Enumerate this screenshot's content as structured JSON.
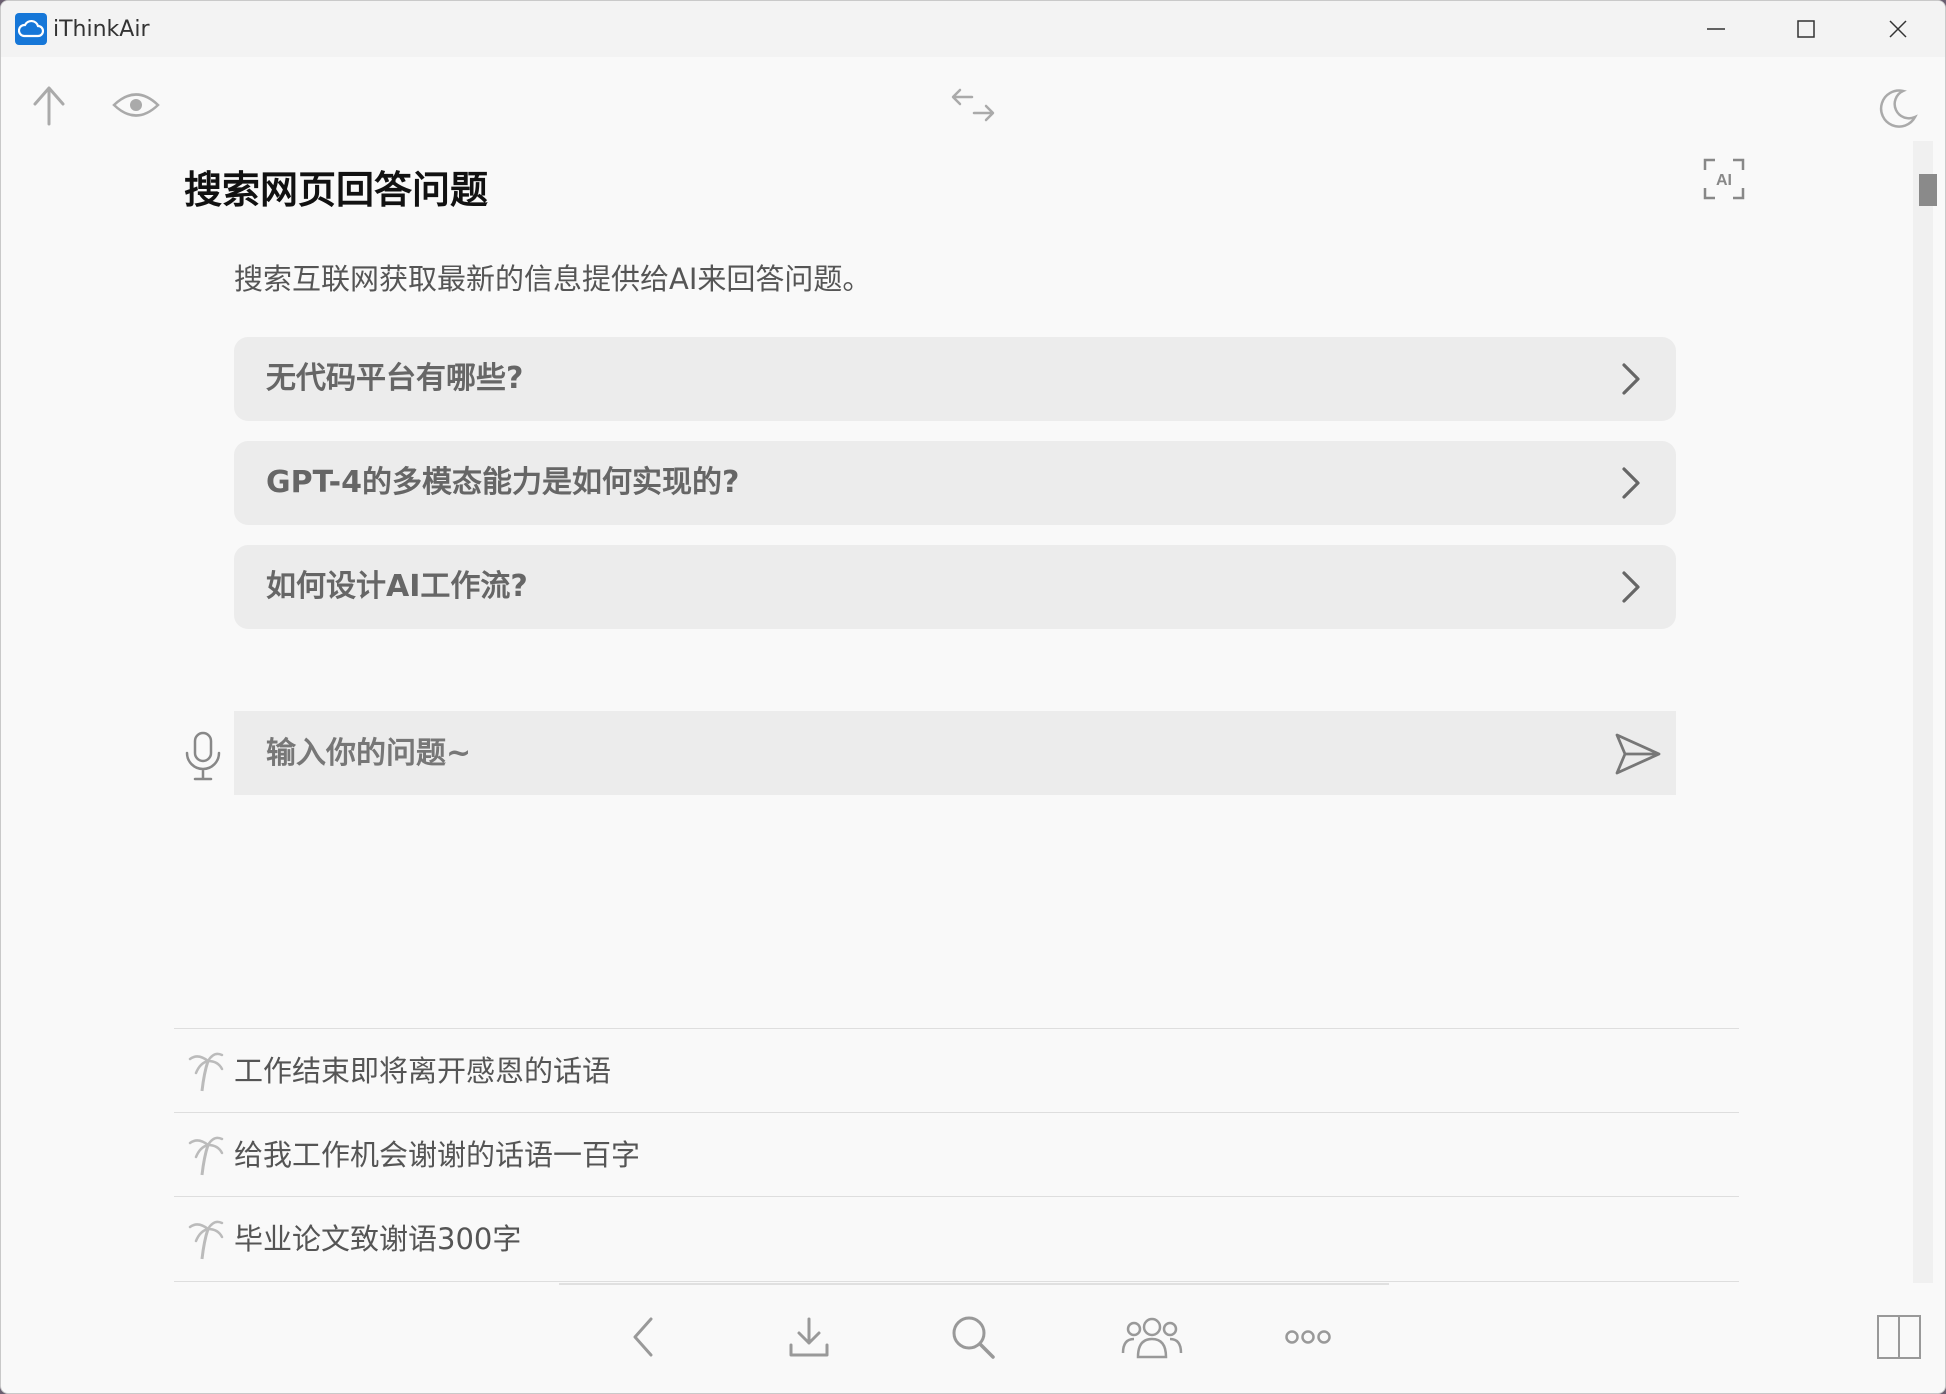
{
  "window": {
    "title": "iThinkAir"
  },
  "toolbar": {
    "icons": [
      "upload-icon",
      "eye-icon",
      "swap-icon",
      "moon-icon"
    ]
  },
  "main": {
    "heading": "搜索网页回答问题",
    "subtitle": "搜索互联网获取最新的信息提供给AI来回答问题。",
    "suggestions": [
      "无代码平台有哪些?",
      "GPT-4的多模态能力是如何实现的?",
      "如何设计AI工作流?"
    ],
    "input": {
      "placeholder": "输入你的问题~",
      "value": ""
    }
  },
  "history": [
    "工作结束即将离开感恩的话语",
    "给我工作机会谢谢的话语一百字",
    "毕业论文致谢语300字"
  ],
  "bottom_nav": {
    "icons": [
      "back-icon",
      "download-icon",
      "search-icon",
      "group-icon",
      "more-icon",
      "split-view-icon"
    ]
  },
  "colors": {
    "accent": "#1677d8",
    "card_bg": "#ececec",
    "window_bg": "#f9f9f9"
  }
}
